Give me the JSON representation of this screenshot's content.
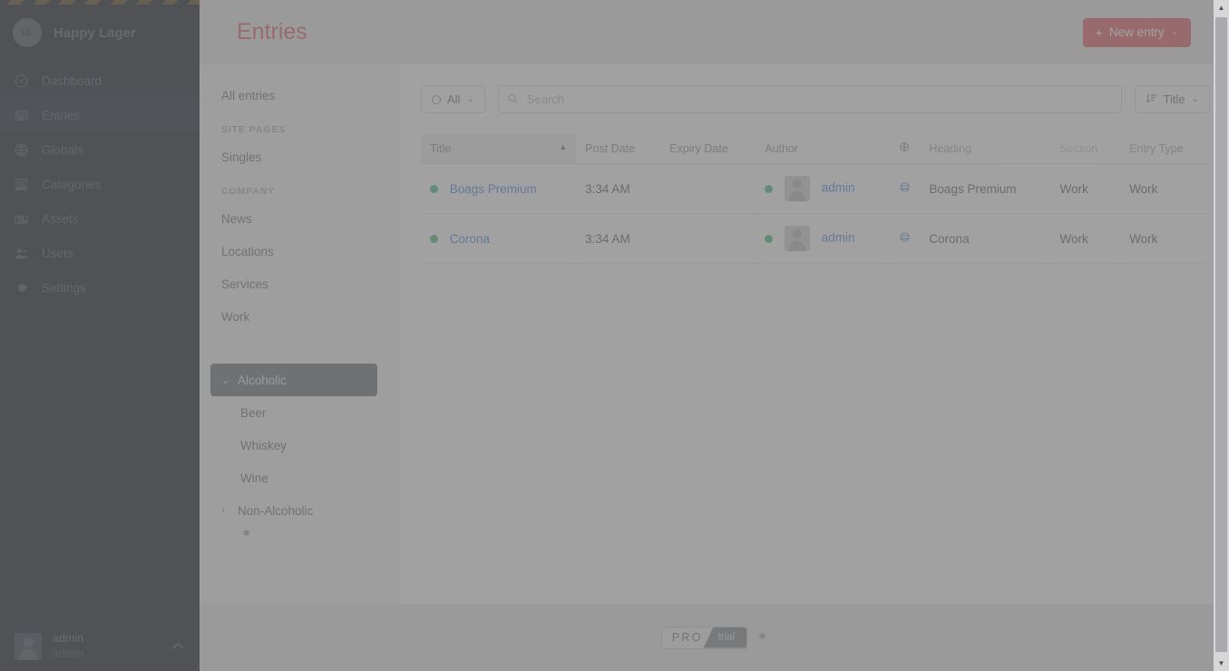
{
  "sidebar": {
    "site_name": "Happy Lager",
    "logo_text": "HL",
    "items": [
      {
        "label": "Dashboard",
        "icon": "gauge-icon"
      },
      {
        "label": "Entries",
        "icon": "newspaper-icon"
      },
      {
        "label": "Globals",
        "icon": "globe-icon"
      },
      {
        "label": "Categories",
        "icon": "archive-icon"
      },
      {
        "label": "Assets",
        "icon": "photos-icon"
      },
      {
        "label": "Users",
        "icon": "users-icon"
      },
      {
        "label": "Settings",
        "icon": "gear-icon"
      }
    ],
    "selected": "Entries",
    "account": {
      "name": "admin",
      "username": "admin",
      "chevron": "chevron-up-icon"
    }
  },
  "header": {
    "title": "Entries",
    "new_entry_label": "New entry",
    "new_entry_plus": "+",
    "new_entry_caret": "⌄"
  },
  "content_sidebar": {
    "all_entries": "All entries",
    "groups": [
      {
        "heading": "SITE PAGES",
        "items": [
          "Singles"
        ]
      },
      {
        "heading": "COMPANY",
        "items": [
          "News",
          "Locations",
          "Services",
          "Work"
        ]
      }
    ],
    "structure": [
      {
        "label": "Alcoholic",
        "toggle": "⌄",
        "active": true,
        "children": [
          "Beer",
          "Whiskey",
          "Wine"
        ]
      },
      {
        "label": "Non-Alcoholic",
        "toggle": "›",
        "active": false,
        "children": []
      }
    ],
    "gear_icon": "gear-icon"
  },
  "toolbar": {
    "status_filter": "All",
    "status_caret": "⌄",
    "search_placeholder": "Search",
    "search_value": "",
    "sort_label": "Title",
    "sort_caret": "⌄"
  },
  "table": {
    "columns": [
      "Title",
      "Post Date",
      "Expiry Date",
      "Author",
      "",
      "Heading",
      "Section",
      "Entry Type"
    ],
    "sorted_column": "Title",
    "sort_direction": "▲",
    "rows": [
      {
        "status": "live",
        "title": "Boags Premium",
        "post_date": "3:34 AM",
        "expiry_date": "",
        "author_status": "live",
        "author": "admin",
        "site": "globe-icon",
        "heading": "Boags Premium",
        "section": "Work",
        "entry_type": "Work"
      },
      {
        "status": "live",
        "title": "Corona",
        "post_date": "3:34 AM",
        "expiry_date": "",
        "author_status": "live",
        "author": "admin",
        "site": "globe-icon",
        "heading": "Corona",
        "section": "Work",
        "entry_type": "Work"
      }
    ]
  },
  "footer": {
    "edition_pro": "PRO",
    "edition_trial": "trial",
    "edition_gear": "gear-icon"
  },
  "colors": {
    "accent_red": "#e12d39",
    "sidebar_bg": "#1c2029",
    "status_green": "#18a957",
    "link_blue": "#1f5fd8",
    "devmode_stripe": "#9c7218"
  }
}
